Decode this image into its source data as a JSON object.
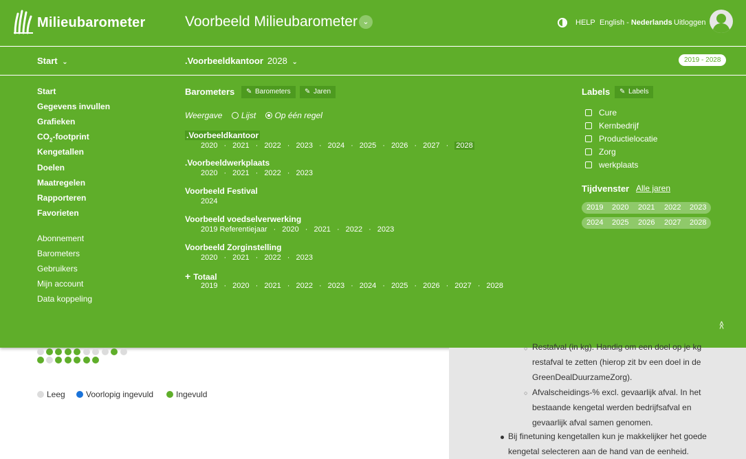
{
  "header": {
    "brand": "Milieubarometer",
    "title": "Voorbeeld Milieubarometer",
    "help": "HELP",
    "language_en": "English",
    "language_sep": " - ",
    "language_nl": "Nederlands",
    "logout": "Uitloggen"
  },
  "subbar": {
    "start": "Start",
    "office": ".Voorbeeldkantoor",
    "office_year": "2028",
    "range": "2019 - 2028"
  },
  "nav": {
    "main": [
      "Start",
      "Gegevens invullen",
      "Grafieken",
      "CO",
      "Kengetallen",
      "Doelen",
      "Maatregelen",
      "Rapporteren",
      "Favorieten"
    ],
    "co2_sub": "2",
    "co2_rest": "-footprint",
    "admin": [
      "Abonnement",
      "Barometers",
      "Gebruikers",
      "Mijn account",
      "Data koppeling"
    ]
  },
  "barometers": {
    "title": "Barometers",
    "btn_barometers": "Barometers",
    "btn_jaren": "Jaren",
    "weergave": "Weergave",
    "opt_lijst": "Lijst",
    "opt_regel": "Op één regel",
    "items": [
      {
        "name": ".Voorbeeldkantoor",
        "years": [
          "2020",
          "2021",
          "2022",
          "2023",
          "2024",
          "2025",
          "2026",
          "2027",
          "2028"
        ],
        "selected_year": "2028"
      },
      {
        "name": ".Voorbeeldwerkplaats",
        "years": [
          "2020",
          "2021",
          "2022",
          "2023"
        ]
      },
      {
        "name": "Voorbeeld Festival",
        "years": [
          "2024"
        ]
      },
      {
        "name": "Voorbeeld voedselverwerking",
        "years": [
          "2019 Referentiejaar",
          "2020",
          "2021",
          "2022",
          "2023"
        ]
      },
      {
        "name": "Voorbeeld Zorginstelling",
        "years": [
          "2020",
          "2021",
          "2022",
          "2023"
        ]
      },
      {
        "name": "Totaal",
        "years": [
          "2019",
          "2020",
          "2021",
          "2022",
          "2023",
          "2024",
          "2025",
          "2026",
          "2027",
          "2028"
        ]
      }
    ]
  },
  "labels": {
    "title": "Labels",
    "btn": "Labels",
    "items": [
      "Cure",
      "Kernbedrijf",
      "Productielocatie",
      "Zorg",
      "werkplaats"
    ]
  },
  "tijdvenster": {
    "title": "Tijdvenster",
    "link": "Alle jaren",
    "row1": [
      "2019",
      "2020",
      "2021",
      "2022",
      "2023"
    ],
    "row2": [
      "2024",
      "2025",
      "2026",
      "2027",
      "2028"
    ]
  },
  "legend": {
    "leeg": "Leeg",
    "voorlopig": "Voorlopig ingevuld",
    "ingevuld": "Ingevuld"
  },
  "sidecol": {
    "lines": [
      "Restafval (in kg). Handig om een doel op je kg",
      "restafval te zetten (hierop zit bv een doel in de",
      "GreenDealDuurzameZorg).",
      "Afvalscheidings-% excl. gevaarlijk afval. In het",
      "bestaande kengetal werden bedrijfsafval en",
      "gevaarlijk afval samen genomen.",
      "Bij finetuning kengetallen kun je makkelijker het goede",
      "kengetal selecteren aan de hand van de eenheid."
    ]
  },
  "colors": {
    "brand_green": "#5fae2a",
    "dot_green": "#5fae2a",
    "dot_blue": "#1a73d9",
    "dot_grey": "#dcdcdc"
  }
}
